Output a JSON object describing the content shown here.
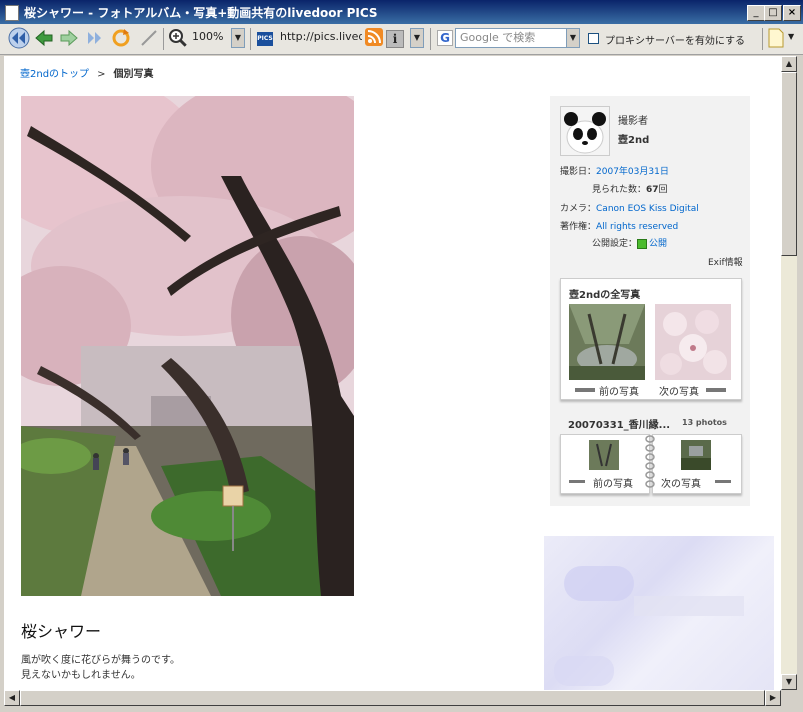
{
  "window": {
    "title": "桜シャワー - フォトアルバム・写真+動画共有のlivedoor PICS",
    "controls": {
      "minimize": "_",
      "maximize": "□",
      "close": "×"
    }
  },
  "toolbar": {
    "zoom": "100%",
    "address": "http://pics.livedo",
    "search_placeholder": "で検索",
    "search_engine": "Google",
    "proxy_label": "プロキシサーバーを有効にする",
    "pics_badge": "PICS",
    "info_glyph": "i"
  },
  "page": {
    "breadcrumb": {
      "home": "壺2ndのトップ",
      "separator": ">",
      "current": "個別写真"
    },
    "photo_title": "桜シャワー",
    "description": [
      "風が吹く度に花びらが舞うのです。",
      "見えないかもしれません。"
    ]
  },
  "sidebar": {
    "photographer_label": "撮影者",
    "photographer_name": "壺2nd",
    "date_label": "撮影日：",
    "date_value": "2007年03月31日",
    "views_label": "見られた数：",
    "views_value": "67",
    "views_unit": "回",
    "camera_label": "カメラ：",
    "camera_value": "Canon EOS Kiss Digital",
    "copyright_label": "著作権：",
    "copyright_value": "All rights reserved",
    "privacy_label": "公開設定：",
    "privacy_value": "公開",
    "exif_link": "Exif情報",
    "all_photos_title": "壺2ndの全写真",
    "prev_label": "前の写真",
    "next_label": "次の写真",
    "album_title": "20070331_香川縁...",
    "album_count": "13 photos"
  },
  "colors": {
    "link": "#0066cc",
    "titlebar": "#0a246a",
    "panel_bg": "#f2f2f2"
  }
}
